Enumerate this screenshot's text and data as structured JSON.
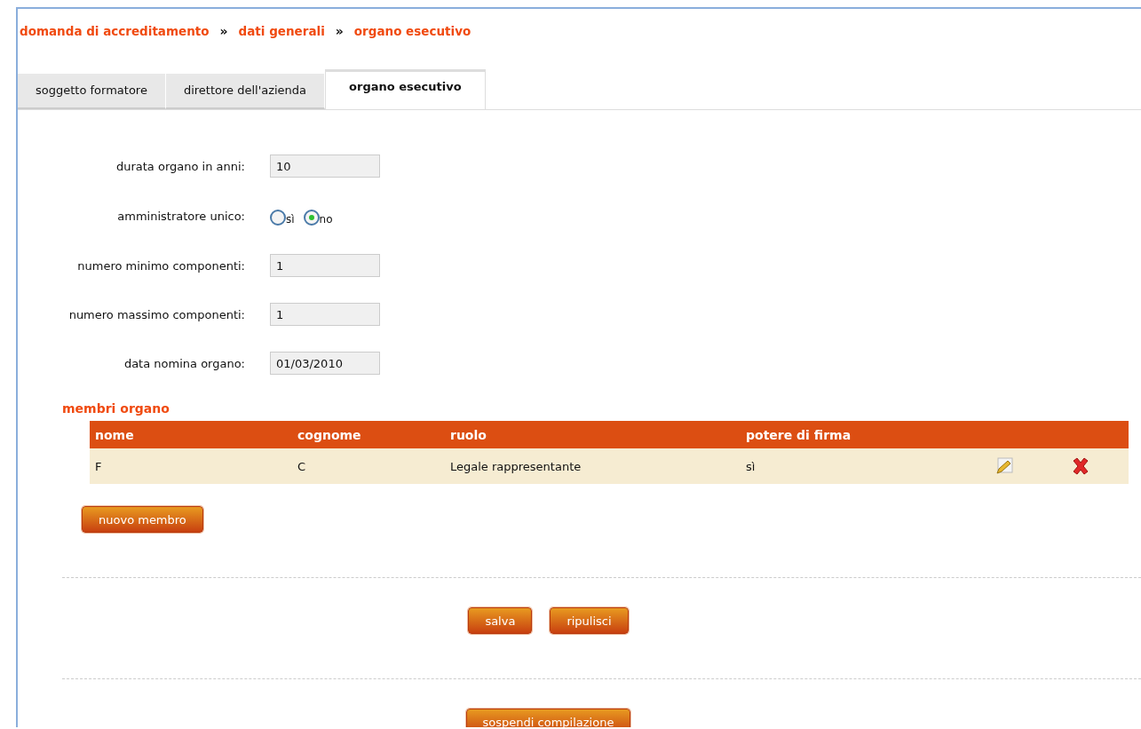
{
  "breadcrumb": [
    {
      "label": "domanda di accreditamento"
    },
    {
      "label": "dati generali"
    },
    {
      "label": "organo esecutivo"
    }
  ],
  "breadcrumb_separator": "»",
  "tabs": [
    {
      "label": "soggetto formatore",
      "selected": false
    },
    {
      "label": "direttore dell'azienda",
      "selected": false
    },
    {
      "label": "organo esecutivo",
      "selected": true
    }
  ],
  "fields": [
    {
      "kind": "text",
      "label": "durata organo in anni:",
      "value": "10"
    },
    {
      "kind": "radio",
      "label": "amministratore unico:",
      "options": [
        {
          "label": "sì",
          "selected": false
        },
        {
          "label": "no",
          "selected": true
        }
      ]
    },
    {
      "kind": "text",
      "label": "numero minimo componenti:",
      "value": "1"
    },
    {
      "kind": "text",
      "label": "numero massimo componenti:",
      "value": "1"
    },
    {
      "kind": "text",
      "label": "data nomina organo:",
      "value": "01/03/2010"
    }
  ],
  "members": {
    "title": "membri organo",
    "columns": [
      "nome",
      "cognome",
      "ruolo",
      "potere di firma"
    ],
    "rows": [
      {
        "cells": [
          "F",
          "C",
          "Legale rappresentante",
          "sì"
        ]
      }
    ],
    "add_button": "nuovo membro"
  },
  "buttons": [
    "salva",
    "ripulisci"
  ],
  "suspend_button": "sospendi compilazione"
}
